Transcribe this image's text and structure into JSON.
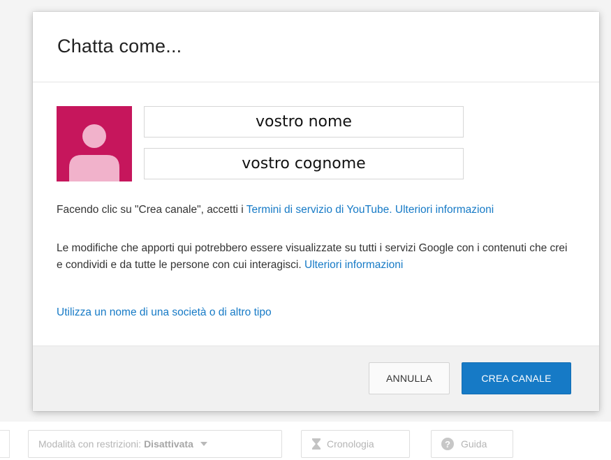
{
  "dialog": {
    "title": "Chatta come...",
    "first_name_value": "vostro nome",
    "last_name_value": "vostro cognome",
    "terms": {
      "prefix": "Facendo clic su \"Crea canale\", accetti i ",
      "terms_link": "Termini di servizio di YouTube",
      "separator": ". ",
      "more_info_link": "Ulteriori informazioni"
    },
    "notice": {
      "text": "Le modifiche che apporti qui potrebbero essere visualizzate su tutti i servizi Google con i contenuti che crei e condividi e da tutte le persone con cui interagisci. ",
      "more_info_link": "Ulteriori informazioni"
    },
    "business_name_link": "Utilizza un nome di una società o di altro tipo",
    "cancel_label": "ANNULLA",
    "create_label": "CREA CANALE"
  },
  "page_bar": {
    "restricted_mode_label": "Modalità con restrizioni:",
    "restricted_mode_value": "Disattivata",
    "history_label": "Cronologia",
    "help_label": "Guida"
  },
  "colors": {
    "accent": "#167ac6",
    "avatar_bg": "#c6165c",
    "avatar_silhouette": "#f1b2cb"
  },
  "icons": {
    "avatar": "person-silhouette",
    "history": "hourglass-icon",
    "help": "question-circle-icon",
    "dropdown": "caret-down-icon"
  }
}
